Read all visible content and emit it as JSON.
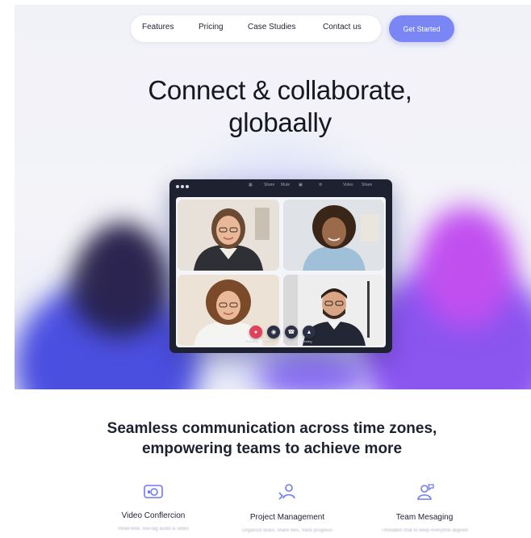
{
  "nav": {
    "links": [
      {
        "label": "Features"
      },
      {
        "label": "Pricing"
      },
      {
        "label": "Case Studies"
      },
      {
        "label": "Contact us"
      }
    ],
    "cta_label": "Get Started"
  },
  "hero": {
    "headline_line1": "Connect & collaborate,",
    "headline_line2": "globaally"
  },
  "app_window": {
    "toolbar": [
      "Share",
      "Mute",
      "Video",
      "Share"
    ],
    "controls": [
      {
        "label": "Recording",
        "icon": "record-icon"
      },
      {
        "label": "Speaker",
        "icon": "speaker-icon"
      },
      {
        "label": "End call",
        "icon": "end-call-icon"
      },
      {
        "label": "Meeting",
        "icon": "meeting-icon"
      }
    ]
  },
  "tagline": {
    "line1": "Seamless communication across time zones,",
    "line2": "empowering teams to achieve more"
  },
  "features": [
    {
      "title": "Video Conflercion",
      "desc": "Reall-time, low-lag audio & video",
      "icon": "video-camera-icon"
    },
    {
      "title": "Project Management",
      "desc": "Organize tasks, share files, track progress",
      "icon": "project-people-icon"
    },
    {
      "title": "Team Mesaging",
      "desc": "Threaded chat to keep everyone aligned",
      "icon": "team-chat-icon"
    }
  ],
  "colors": {
    "accent": "#7a86f3",
    "icon_accent": "#6f7bf0",
    "window_dark": "#1e2130",
    "end_call": "#e0405a"
  }
}
